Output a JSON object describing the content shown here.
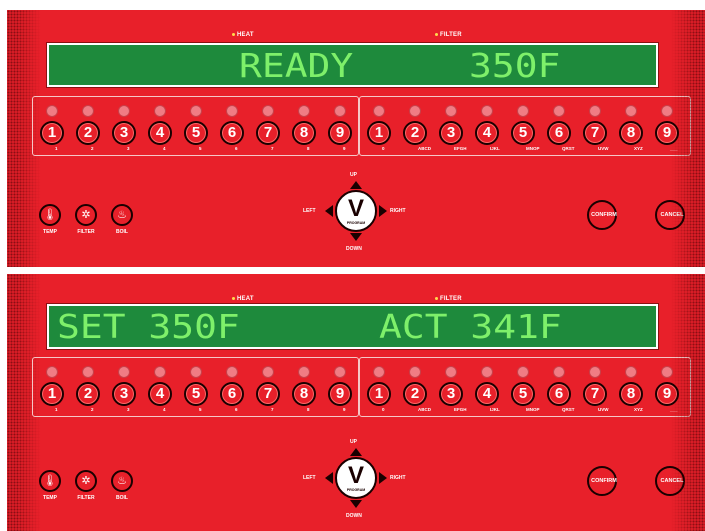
{
  "indicators": {
    "heat": "HEAT",
    "filter": "FILTER"
  },
  "panels": [
    {
      "display_left": "READY",
      "display_right": "350F"
    },
    {
      "display_left": "SET 350F",
      "display_right": "ACT 341F"
    }
  ],
  "left_keys": [
    {
      "num": "1",
      "sub": "1"
    },
    {
      "num": "2",
      "sub": "2"
    },
    {
      "num": "3",
      "sub": "3"
    },
    {
      "num": "4",
      "sub": "4"
    },
    {
      "num": "5",
      "sub": "5"
    },
    {
      "num": "6",
      "sub": "6"
    },
    {
      "num": "7",
      "sub": "7"
    },
    {
      "num": "8",
      "sub": "8"
    },
    {
      "num": "9",
      "sub": "9"
    }
  ],
  "right_keys": [
    {
      "num": "1",
      "sub": "0"
    },
    {
      "num": "2",
      "sub": "ABCD"
    },
    {
      "num": "3",
      "sub": "EFGH"
    },
    {
      "num": "4",
      "sub": "IJKL"
    },
    {
      "num": "5",
      "sub": "MNOP"
    },
    {
      "num": "6",
      "sub": "QRST"
    },
    {
      "num": "7",
      "sub": "UVW"
    },
    {
      "num": "8",
      "sub": "XYZ"
    },
    {
      "num": "9",
      "sub": "___"
    }
  ],
  "function_buttons": [
    {
      "label": "TEMP",
      "icon": "thermometer-icon",
      "glyph": "🌡"
    },
    {
      "label": "FILTER",
      "icon": "filter-icon",
      "glyph": "✲"
    },
    {
      "label": "BOIL",
      "icon": "boil-icon",
      "glyph": "♨"
    }
  ],
  "dpad": {
    "up": "UP",
    "down": "DOWN",
    "left": "LEFT",
    "right": "RIGHT",
    "center": "V",
    "center_label": "PROGRAM"
  },
  "confirm": "CONFIRM",
  "cancel": "CANCEL",
  "colors": {
    "panel": "#e8202a",
    "display_bg": "#1e8a3c",
    "display_text": "#7ef06a",
    "led": "#f07c84"
  }
}
